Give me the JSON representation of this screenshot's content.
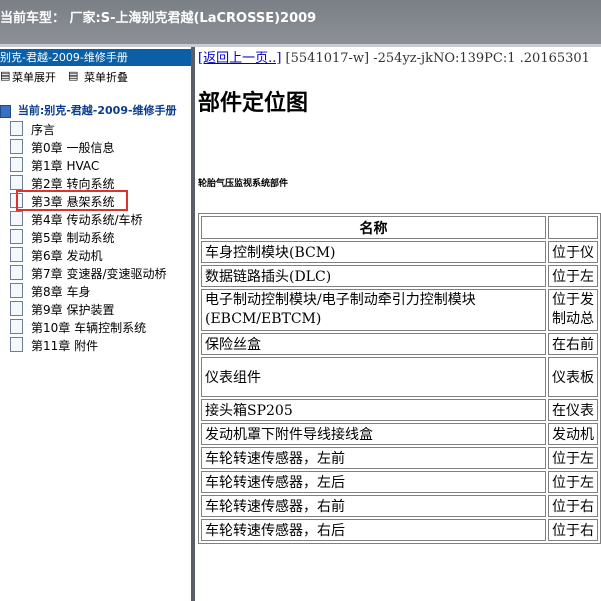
{
  "top_bar": {
    "title": "当前车型：  厂家:S-上海别克君越(LaCROSSE)2009"
  },
  "sidebar": {
    "header": "别克-君越-2009-维修手册",
    "toolbar": {
      "expand": "菜单展开",
      "collapse": "菜单折叠"
    },
    "root_label": "当前:别克-君越-2009-维修手册",
    "items": [
      {
        "label": "序言"
      },
      {
        "label": "第0章 一般信息"
      },
      {
        "label": "第1章 HVAC"
      },
      {
        "label": "第2章 转向系统"
      },
      {
        "label": "第3章 悬架系统"
      },
      {
        "label": "第4章 传动系统/车桥"
      },
      {
        "label": "第5章 制动系统"
      },
      {
        "label": "第6章 发动机"
      },
      {
        "label": "第7章 变速器/变速驱动桥"
      },
      {
        "label": "第8章 车身"
      },
      {
        "label": "第9章 保护装置"
      },
      {
        "label": "第10章 车辆控制系统"
      },
      {
        "label": "第11章 附件"
      }
    ],
    "highlight_color": "#e0322d"
  },
  "content": {
    "back_link": "[返回上一页..]",
    "breadcrumb_meta": " [5541017-w] -254yz-jkNO:139PC:1 .20165301",
    "page_title": "部件定位图",
    "section_title": "轮胎气压监视系统部件",
    "table": {
      "header": {
        "name": "名称",
        "location": ""
      },
      "rows": [
        {
          "name": "车身控制模块(BCM)",
          "location": "位于仪"
        },
        {
          "name": "数据链路插头(DLC)",
          "location": "位于左"
        },
        {
          "name": "电子制动控制模块/电子制动牵引力控制模块(EBCM/EBTCM)",
          "location": "位于发制动总"
        },
        {
          "name": "保险丝盒",
          "location": "在右前"
        },
        {
          "name": "仪表组件",
          "location": "仪表板"
        },
        {
          "name": "接头箱SP205",
          "location": "在仪表"
        },
        {
          "name": "发动机罩下附件导线接线盒",
          "location": "发动机"
        },
        {
          "name": "车轮转速传感器，左前",
          "location": "位于左"
        },
        {
          "name": "车轮转速传感器，左后",
          "location": "位于左"
        },
        {
          "name": "车轮转速传感器，右前",
          "location": "位于右"
        },
        {
          "name": "车轮转速传感器，右后",
          "location": "位于右"
        }
      ]
    }
  }
}
